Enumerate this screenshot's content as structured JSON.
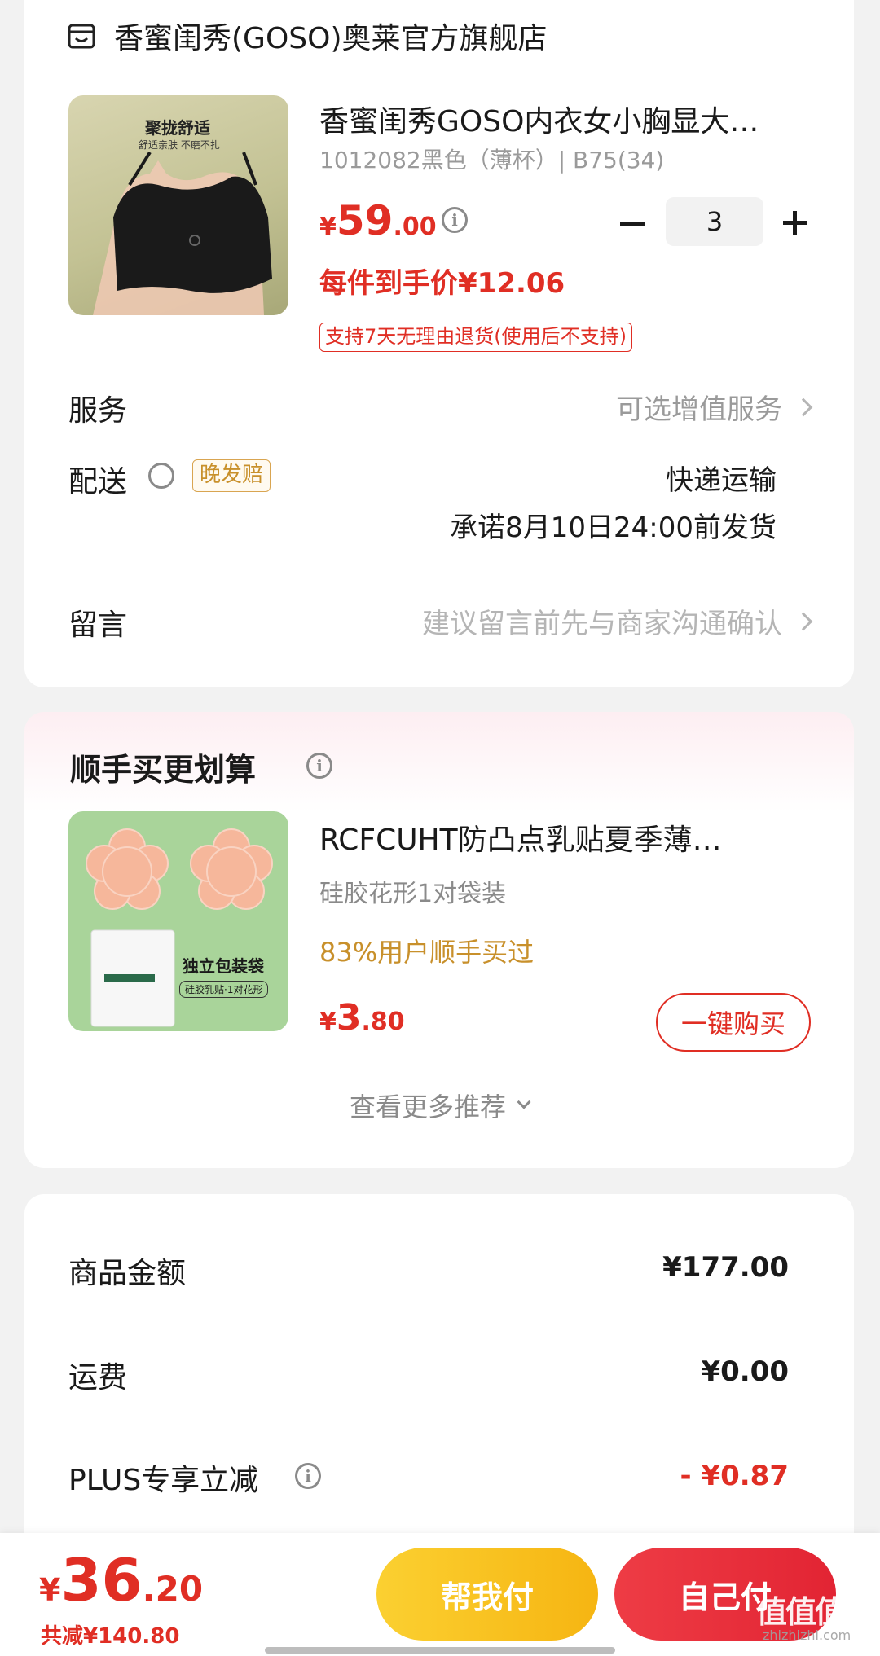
{
  "store": {
    "name": "香蜜闺秀(GOSO)奥莱官方旗舰店",
    "icon": "store-icon"
  },
  "product": {
    "image_text_title": "聚拢舒适",
    "image_text_sub": "舒适亲肤 不磨不扎",
    "title": "香蜜闺秀GOSO内衣女小胸显大…",
    "sku": "1012082黑色（薄杯）| B75(34)",
    "price_symbol": "¥",
    "price_int": "59",
    "price_dec": ".00",
    "unit_price": "每件到手价¥12.06",
    "return_tag": "支持7天无理由退货(使用后不支持)",
    "quantity": "3",
    "minus": "−",
    "plus": "+"
  },
  "service": {
    "label": "服务",
    "value": "可选增值服务"
  },
  "delivery": {
    "label": "配送",
    "late_tag": "晚发赔",
    "method": "快递运输",
    "promise": "承诺8月10日24:00前发货"
  },
  "message": {
    "label": "留言",
    "placeholder": "建议留言前先与商家沟通确认"
  },
  "upsell": {
    "title": "顺手买更划算",
    "item": {
      "image_text": "独立包装袋",
      "image_sub": "硅胶乳贴·1对花形",
      "title": "RCFCUHT防凸点乳贴夏季薄…",
      "spec": "硅胶花形1对袋装",
      "stat": "83%用户顺手买过",
      "price_symbol": "¥",
      "price_int": "3",
      "price_dec": ".80",
      "buy_label": "一键购买"
    },
    "more_label": "查看更多推荐"
  },
  "summary": {
    "goods_label": "商品金额",
    "goods_value": "¥177.00",
    "shipping_label": "运费",
    "shipping_value": "¥0.00",
    "plus_label": "PLUS专享立减",
    "plus_value": "- ¥0.87"
  },
  "bottom": {
    "total_symbol": "¥",
    "total_int": "36",
    "total_dec": ".20",
    "saved": "共减¥140.80",
    "help_pay": "帮我付",
    "self_pay": "自己付"
  },
  "watermark": {
    "logo": "值值值",
    "url": "zhizhizhi.com"
  },
  "colors": {
    "accent_red": "#e02e24",
    "gold": "#c8902b",
    "help_pay_bg": "#f9c120",
    "self_pay_bg": "#ea2f3d"
  }
}
